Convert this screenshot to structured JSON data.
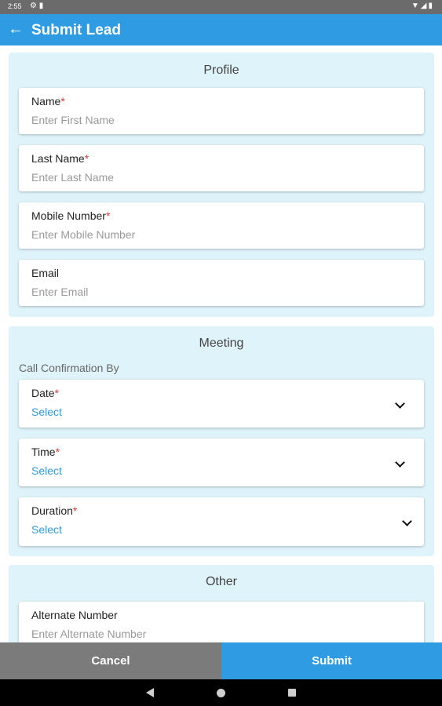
{
  "status_bar": {
    "time": "2:55",
    "left_icons": [
      "gear-icon",
      "sd-card-icon"
    ],
    "right_icons": [
      "wifi-icon",
      "signal-icon",
      "battery-icon"
    ]
  },
  "app_bar": {
    "back_icon": "arrow-left-icon",
    "title": "Submit Lead"
  },
  "profile": {
    "title": "Profile",
    "fields": [
      {
        "label": "Name",
        "required": "*",
        "placeholder": "Enter First Name"
      },
      {
        "label": "Last Name",
        "required": "*",
        "placeholder": "Enter Last Name"
      },
      {
        "label": "Mobile Number",
        "required": "*",
        "placeholder": "Enter Mobile Number"
      },
      {
        "label": "Email",
        "required": "",
        "placeholder": "Enter Email"
      }
    ]
  },
  "meeting": {
    "title": "Meeting",
    "subhead": "Call Confirmation By",
    "fields": [
      {
        "label": "Date",
        "required": "*",
        "value": "Select"
      },
      {
        "label": "Time",
        "required": "*",
        "value": "Select"
      },
      {
        "label": "Duration",
        "required": "*",
        "value": "Select"
      }
    ]
  },
  "other": {
    "title": "Other",
    "fields": [
      {
        "label": "Alternate Number",
        "required": "",
        "placeholder": "Enter Alternate Number"
      }
    ]
  },
  "buttons": {
    "cancel": "Cancel",
    "submit": "Submit"
  },
  "colors": {
    "primary": "#2f9be3",
    "section_bg": "#dff3fb",
    "required": "#e53935",
    "cancel_bg": "#7b7b7b"
  }
}
